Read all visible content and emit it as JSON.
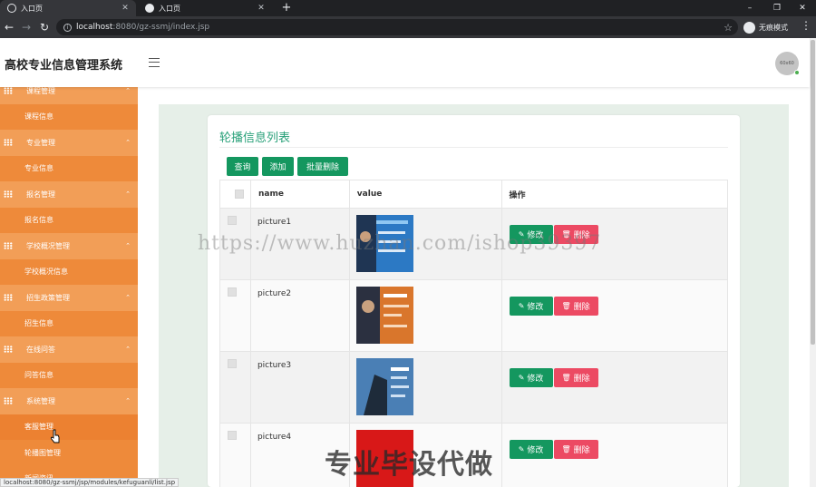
{
  "browser": {
    "tabs": [
      {
        "title": "入口页",
        "close": "✕"
      },
      {
        "title": "入口页",
        "close": "✕"
      }
    ],
    "new_tab": "+",
    "window_buttons": {
      "minimize": "–",
      "restore": "❐",
      "close": "✕"
    },
    "url_host": "localhost",
    "url_rest": ":8080/gz-ssmj/index.jsp",
    "incognito_label": "无痕模式",
    "nav": {
      "back": "←",
      "forward": "→",
      "reload": "↻"
    },
    "menu": "⋮",
    "star": "☆"
  },
  "header": {
    "brand": "高校专业信息管理系统",
    "avatar_text": "60x60",
    "status_color": "#4caf50"
  },
  "sidebar": {
    "items": [
      {
        "type": "group",
        "label": "课程管理"
      },
      {
        "type": "sub",
        "label": "课程信息"
      },
      {
        "type": "group",
        "label": "专业管理"
      },
      {
        "type": "sub",
        "label": "专业信息"
      },
      {
        "type": "group",
        "label": "报名管理"
      },
      {
        "type": "sub",
        "label": "报名信息"
      },
      {
        "type": "group",
        "label": "学校概况管理"
      },
      {
        "type": "sub",
        "label": "学校概况信息"
      },
      {
        "type": "group",
        "label": "招生政策管理"
      },
      {
        "type": "sub",
        "label": "招生信息"
      },
      {
        "type": "group",
        "label": "在线问答"
      },
      {
        "type": "sub",
        "label": "问答信息"
      },
      {
        "type": "group",
        "label": "系统管理"
      },
      {
        "type": "sub",
        "label": "客服管理"
      },
      {
        "type": "sub",
        "label": "轮播图管理"
      },
      {
        "type": "sub",
        "label": "新闻资讯"
      }
    ],
    "color": "#ee8a3a"
  },
  "main": {
    "title": "轮播信息列表",
    "buttons": {
      "search": "查询",
      "add": "添加",
      "batch_delete": "批量删除"
    },
    "table": {
      "columns": [
        "name",
        "value",
        "操作"
      ],
      "rows": [
        {
          "name": "picture1",
          "edit": "修改",
          "delete": "删除"
        },
        {
          "name": "picture2",
          "edit": "修改",
          "delete": "删除"
        },
        {
          "name": "picture3",
          "edit": "修改",
          "delete": "删除"
        },
        {
          "name": "picture4",
          "edit": "修改",
          "delete": "删除"
        }
      ]
    },
    "accent": "#14975f",
    "danger": "#ec4a63"
  },
  "status_bar": "localhost:8080/gz-ssmj/jsp/modules/kefuguanli/list.jsp",
  "watermarks": {
    "url": "https://www.huzhan.com/ishop39397",
    "text": "专业毕设代做"
  }
}
